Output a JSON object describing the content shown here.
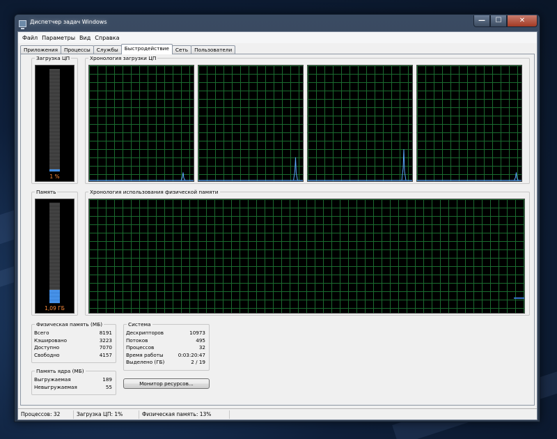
{
  "window": {
    "title": "Диспетчер задач Windows"
  },
  "menu": [
    "Файл",
    "Параметры",
    "Вид",
    "Справка"
  ],
  "tabs": [
    "Приложения",
    "Процессы",
    "Службы",
    "Быстродействие",
    "Сеть",
    "Пользователи"
  ],
  "active_tab": "Быстродействие",
  "cpu": {
    "label": "Загрузка ЦП",
    "value_text": "1 %",
    "percent": 1
  },
  "cpu_history": {
    "label": "Хронология загрузки ЦП",
    "cores": [
      {
        "spikes": [
          [
            0.9,
            0.07
          ]
        ]
      },
      {
        "spikes": [
          [
            0.93,
            0.2
          ]
        ]
      },
      {
        "spikes": [
          [
            0.92,
            0.27
          ]
        ]
      },
      {
        "spikes": [
          [
            0.95,
            0.07
          ]
        ]
      }
    ]
  },
  "memory": {
    "label": "Память",
    "value_text": "1,09 ГБ",
    "fraction": 0.13
  },
  "memory_history": {
    "label": "Хронология использования физической памяти",
    "level": 0.13
  },
  "physical_memory": {
    "title": "Физическая память (МБ)",
    "rows": [
      {
        "label": "Всего",
        "value": "8191"
      },
      {
        "label": "Кэшировано",
        "value": "3223"
      },
      {
        "label": "Доступно",
        "value": "7070"
      },
      {
        "label": "Свободно",
        "value": "4157"
      }
    ]
  },
  "kernel_memory": {
    "title": "Память ядра (МБ)",
    "rows": [
      {
        "label": "Выгружаемая",
        "value": "189"
      },
      {
        "label": "Невыгружаемая",
        "value": "55"
      }
    ]
  },
  "system": {
    "title": "Система",
    "rows": [
      {
        "label": "Дескрипторов",
        "value": "10973"
      },
      {
        "label": "Потоков",
        "value": "495"
      },
      {
        "label": "Процессов",
        "value": "32"
      },
      {
        "label": "Время работы",
        "value": "0:03:20:47"
      },
      {
        "label": "Выделено (ГБ)",
        "value": "2 / 19"
      }
    ]
  },
  "resource_monitor_button": "Монитор ресурсов...",
  "status": {
    "processes": "Процессов: 32",
    "cpu": "Загрузка ЦП: 1%",
    "memory": "Физическая память: 13%"
  },
  "colors": {
    "graph_grid": "#1a6b2f",
    "cpu_line": "#5aa8ff",
    "meter_text": "#ff8c3a"
  }
}
